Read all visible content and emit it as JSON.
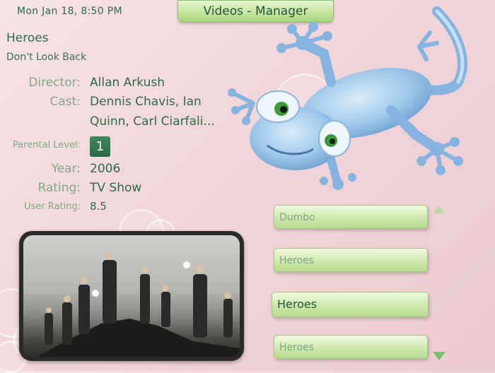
{
  "header": {
    "datetime": "Mon Jan 18, 8:50 PM",
    "title": "Videos - Manager"
  },
  "details": {
    "show_title": "Heroes",
    "episode_title": "Don't Look Back",
    "director_label": "Director:",
    "director": "Allan Arkush",
    "cast_label": "Cast:",
    "cast_line1": "Dennis Chavis, Ian",
    "cast_line2": "Quinn, Carl Ciarfali...",
    "parental_label": "Parental Level:",
    "parental_value": "1",
    "year_label": "Year:",
    "year": "2006",
    "rating_label": "Rating:",
    "rating": "TV Show",
    "user_rating_label": "User Rating:",
    "user_rating": "8.5"
  },
  "poster": {
    "icon": "cover-art-image"
  },
  "list": {
    "items": [
      {
        "label": "Dumbo",
        "selected": false
      },
      {
        "label": "Heroes",
        "selected": false
      },
      {
        "label": "Heroes",
        "selected": true
      },
      {
        "label": "Heroes",
        "selected": false
      }
    ],
    "scroll_up_icon": "triangle-up-icon",
    "scroll_down_icon": "triangle-down-icon"
  },
  "decor": {
    "mascot_icon": "gecko-mascot-icon",
    "colors": {
      "accent_green": "#2f6a4a",
      "button_green": "#cfe8ad",
      "background_pink": "#f1d5d9"
    }
  }
}
